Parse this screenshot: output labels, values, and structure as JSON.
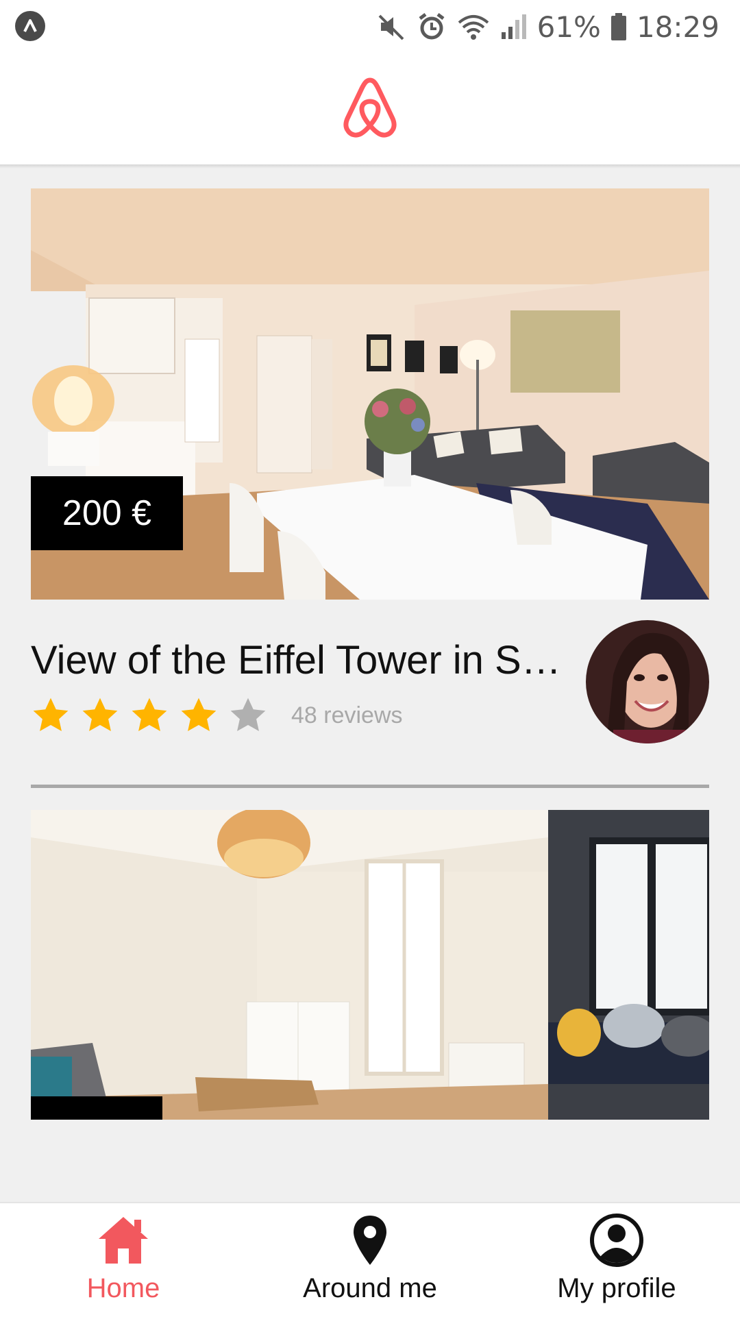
{
  "status_bar": {
    "battery": "61%",
    "time": "18:29"
  },
  "listings": [
    {
      "price": "200 €",
      "title": "View of the Eiffel Tower in S…",
      "rating": 4,
      "rating_max": 5,
      "reviews": "48 reviews"
    },
    {
      "price": ""
    }
  ],
  "tabs": [
    {
      "label": "Home",
      "icon": "home-icon",
      "active": true
    },
    {
      "label": "Around me",
      "icon": "location-pin-icon",
      "active": false
    },
    {
      "label": "My profile",
      "icon": "user-circle-icon",
      "active": false
    }
  ],
  "colors": {
    "brand": "#ff5a5f",
    "active_tab": "#f2585e",
    "star_filled": "#ffb400",
    "star_empty": "#b0b0b0"
  }
}
